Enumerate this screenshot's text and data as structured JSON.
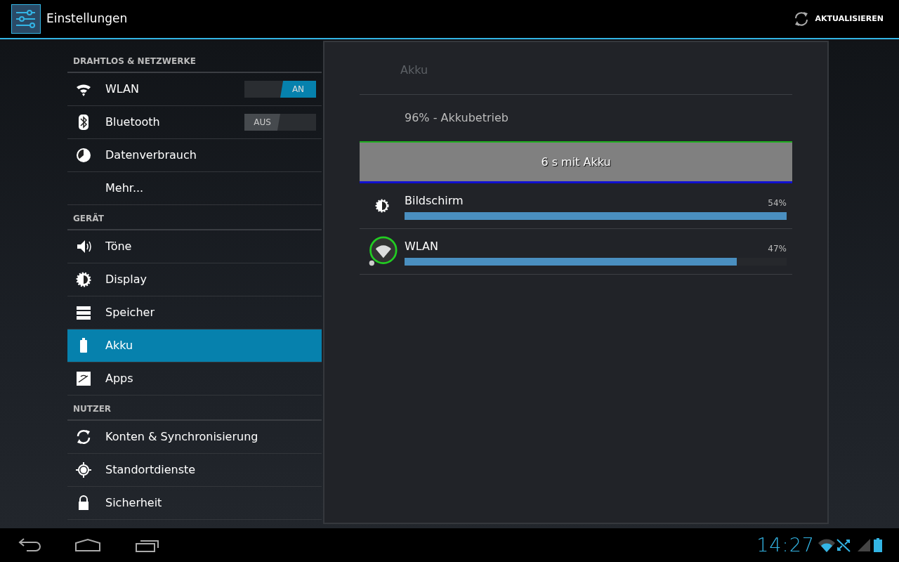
{
  "action_bar": {
    "title": "Einstellungen",
    "action": "AKTUALISIEREN"
  },
  "sections": [
    {
      "header": "DRAHTLOS & NETZWERKE",
      "items": [
        {
          "label": "WLAN",
          "kind": "toggle",
          "on": true,
          "toggle_label": "AN",
          "selected": false
        },
        {
          "label": "Bluetooth",
          "kind": "toggle",
          "on": false,
          "toggle_label": "AUS",
          "selected": false
        },
        {
          "label": "Datenverbrauch",
          "kind": "plain",
          "selected": false
        },
        {
          "label": "Mehr...",
          "kind": "plain",
          "selected": false
        }
      ]
    },
    {
      "header": "GERÄT",
      "items": [
        {
          "label": "Töne",
          "kind": "plain",
          "selected": false
        },
        {
          "label": "Display",
          "kind": "plain",
          "selected": false
        },
        {
          "label": "Speicher",
          "kind": "plain",
          "selected": false
        },
        {
          "label": "Akku",
          "kind": "plain",
          "selected": true
        },
        {
          "label": "Apps",
          "kind": "plain",
          "selected": false
        }
      ]
    },
    {
      "header": "NUTZER",
      "items": [
        {
          "label": "Konten & Synchronisierung",
          "kind": "plain",
          "selected": false
        },
        {
          "label": "Standortdienste",
          "kind": "plain",
          "selected": false
        },
        {
          "label": "Sicherheit",
          "kind": "plain",
          "selected": false
        }
      ]
    }
  ],
  "detail": {
    "title": "Akku",
    "status": "96% - Akkubetrieb",
    "graph_label": "6 s mit Akku",
    "usage": [
      {
        "name": "Bildschirm",
        "percent": "54%",
        "level": 1.0
      },
      {
        "name": "WLAN",
        "percent": "47%",
        "level": 0.87
      }
    ]
  },
  "status_bar": {
    "time": "14:27"
  }
}
